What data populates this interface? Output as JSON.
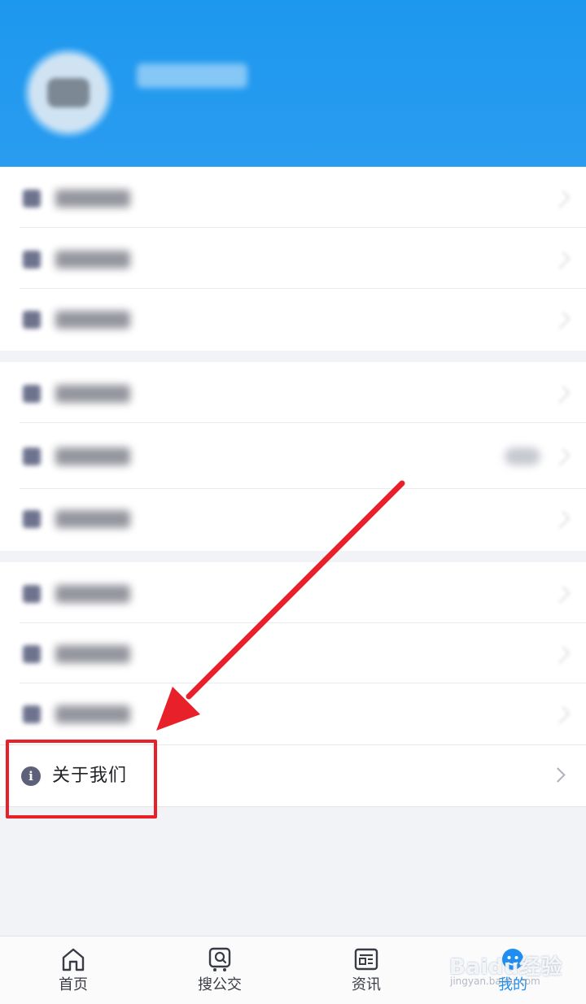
{
  "menu": {
    "about_label": "关于我们",
    "info_icon_glyph": "i"
  },
  "tabbar": {
    "tabs": [
      {
        "label": "首页",
        "icon": "home-icon"
      },
      {
        "label": "搜公交",
        "icon": "search-bus-icon"
      },
      {
        "label": "资讯",
        "icon": "news-icon"
      },
      {
        "label": "我的",
        "icon": "profile-icon",
        "active": true
      }
    ]
  },
  "watermark": {
    "text": "Baidu经验",
    "sub": "jingyan.baidu.com"
  },
  "colors": {
    "header_blue": "#1c98ee",
    "accent_blue": "#1e8ff0",
    "annotation_red": "#e8202a"
  }
}
